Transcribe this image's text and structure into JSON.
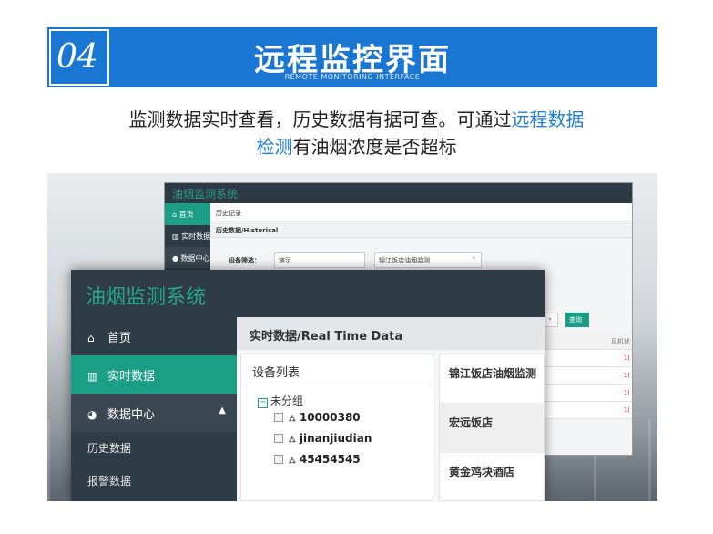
{
  "banner": {
    "number": "04",
    "title": "远程监控界面",
    "subtitle": "REMOTE MONITORING INTERFACE",
    "color": "#1976d2"
  },
  "description": {
    "line1_pre": "监测数据实时查看，历史数据有据可查。可通过",
    "line1_highlight": "远程数据",
    "line2_highlight": "检测",
    "line2_post": "有油烟浓度是否超标"
  },
  "back_screen": {
    "app_title": "油烟监测系统",
    "sidebar": [
      {
        "icon": "home-icon",
        "label": "首页"
      },
      {
        "icon": "bar-chart-icon",
        "label": "实时数据"
      },
      {
        "icon": "pie-chart-icon",
        "label": "数据中心"
      }
    ],
    "breadcrumb": "历史记录",
    "page_title": "历史数据/Historical",
    "filter_label": "设备筛选：",
    "filter_value": "演示",
    "device_select": "锦江饭店油烟监测",
    "query_button": "查询",
    "table_headers": [
      "≎",
      "风机状"
    ],
    "table_rows": [
      "1(",
      "1(",
      "1(",
      "1("
    ]
  },
  "front_screen": {
    "app_title": "油烟监测系统",
    "sidebar": {
      "home": "首页",
      "realtime": "实时数据",
      "data_center": "数据中心",
      "history": "历史数据",
      "alarm": "报警数据"
    },
    "main_title": "实时数据/Real Time Data",
    "device_panel": {
      "title": "设备列表",
      "group": "未分组",
      "devices": [
        "10000380",
        "jinanjiudian",
        "45454545"
      ]
    },
    "shops": [
      "锦江饭店油烟监测",
      "宏远饭店",
      "黄金鸡块酒店"
    ],
    "accent_color": "#1a9e86"
  }
}
